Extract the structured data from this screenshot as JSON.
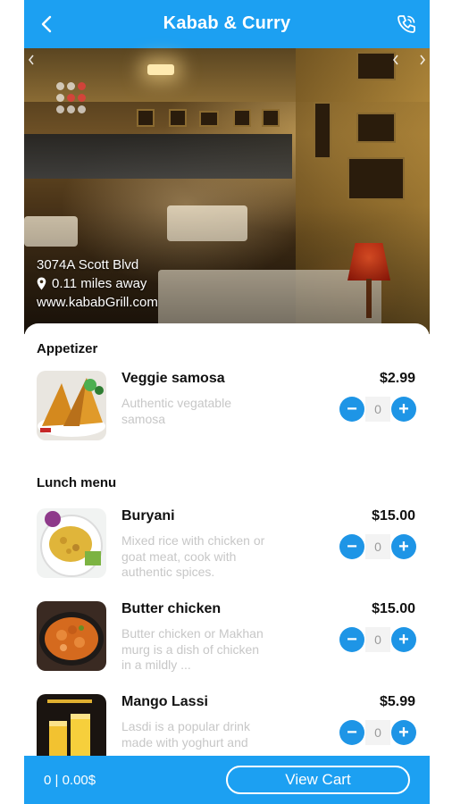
{
  "header": {
    "title": "Kabab & Curry",
    "back_icon": "chevron-left-icon",
    "call_icon": "phone-call-icon",
    "bg_color": "#1ca0f2"
  },
  "hero": {
    "address": "3074A Scott Blvd",
    "distance": "0.11 miles away",
    "website": "www.kababGrill.com",
    "prev_icon": "chevron-left-icon",
    "next_icon": "chevron-right-icon"
  },
  "menu": {
    "sections": [
      {
        "title": "Appetizer",
        "items": [
          {
            "name": "Veggie samosa",
            "description": "Authentic vegatable samosa",
            "price": "$2.99",
            "quantity": "0"
          }
        ]
      },
      {
        "title": "Lunch menu",
        "items": [
          {
            "name": "Buryani",
            "description": "Mixed rice with chicken or goat meat, cook with authentic spices.",
            "price": "$15.00",
            "quantity": "0"
          },
          {
            "name": "Butter chicken",
            "description": "Butter chicken or Makhan murg is a dish of chicken in a mildly ...",
            "price": "$15.00",
            "quantity": "0"
          },
          {
            "name": "Mango Lassi",
            "description": "Lasdi is a popular drink made with yoghurt and",
            "price": "$5.99",
            "quantity": "0"
          }
        ]
      }
    ],
    "stepper": {
      "minus": "−",
      "plus": "+"
    }
  },
  "bottom_bar": {
    "total": "0 | 0.00$",
    "view_cart_label": "View Cart"
  }
}
